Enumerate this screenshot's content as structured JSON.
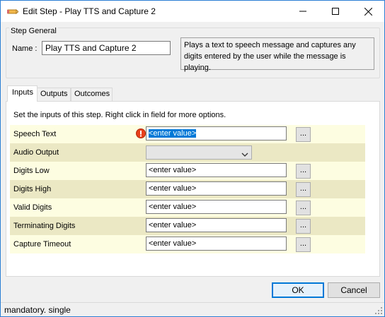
{
  "window": {
    "title": "Edit Step - Play TTS and Capture 2",
    "border_color": "#2b7fd4"
  },
  "step_general": {
    "legend": "Step General",
    "name_label": "Name :",
    "name_value": "Play TTS and Capture 2",
    "description": "Plays a text to speech message and captures any digits entered by the user while the message is playing."
  },
  "tabs": [
    {
      "label": "Inputs",
      "active": true
    },
    {
      "label": "Outputs",
      "active": false
    },
    {
      "label": "Outcomes",
      "active": false
    }
  ],
  "inputs_panel": {
    "description": "Set the inputs of this step.  Right click in field for more options.",
    "ellipsis_label": "...",
    "rows": [
      {
        "label": "Speech Text",
        "value": "<enter value>",
        "mandatory_warning": true,
        "selected": true
      },
      {
        "label": "Audio Output",
        "value": "",
        "type": "dropdown"
      },
      {
        "label": "Digits Low",
        "value": "<enter value>"
      },
      {
        "label": "Digits High",
        "value": "<enter value>"
      },
      {
        "label": "Valid Digits",
        "value": "<enter value>"
      },
      {
        "label": "Terminating Digits",
        "value": "<enter value>"
      },
      {
        "label": "Capture Timeout",
        "value": "<enter value>"
      }
    ],
    "row_colors": {
      "odd": "#fdfde1",
      "even": "#ebe8c4"
    }
  },
  "buttons": {
    "ok_label": "OK",
    "cancel_label": "Cancel"
  },
  "status": {
    "text": "mandatory. single"
  },
  "icons": {
    "app": "pencil-icon",
    "minimize": "minimize-icon",
    "maximize": "maximize-icon",
    "close": "close-icon",
    "warning": "warning-icon",
    "dropdown": "chevron-down-icon",
    "grip": "resize-grip-icon"
  },
  "colors": {
    "accent": "#0078d7",
    "warning": "#e8401c"
  }
}
